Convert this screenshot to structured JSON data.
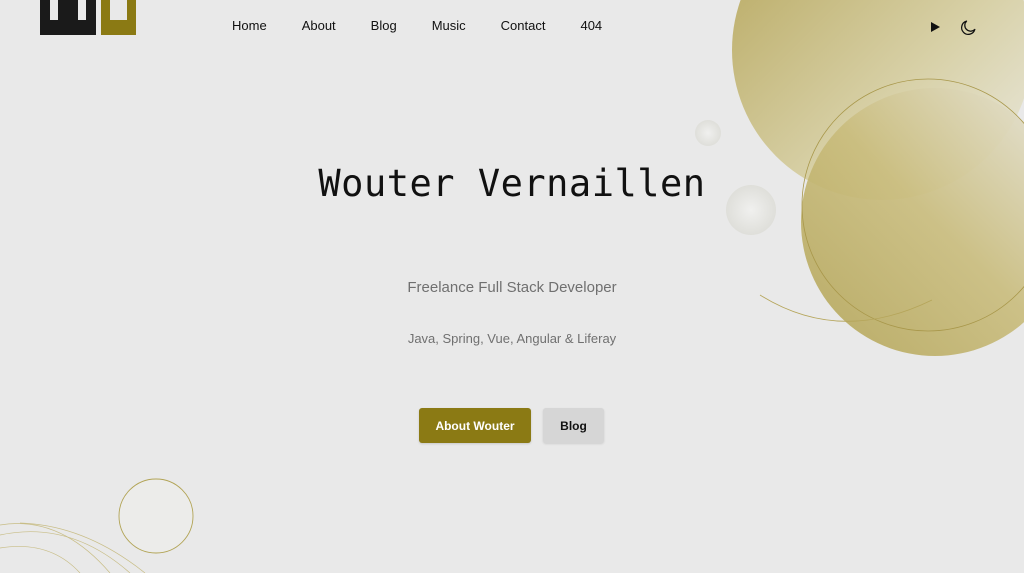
{
  "header": {
    "logo": "WV-logo",
    "nav": [
      {
        "label": "Home"
      },
      {
        "label": "About"
      },
      {
        "label": "Blog"
      },
      {
        "label": "Music"
      },
      {
        "label": "Contact"
      },
      {
        "label": "404"
      }
    ],
    "icons": [
      "play-icon",
      "moon-icon"
    ]
  },
  "hero": {
    "title": "Wouter Vernaillen",
    "subtitle": "Freelance Full Stack Developer",
    "tech": "Java, Spring, Vue, Angular & Liferay",
    "primary_button": "About Wouter",
    "secondary_button": "Blog"
  },
  "colors": {
    "background": "#e9e9e9",
    "accent": "#8b7a14",
    "secondary_button": "#d6d6d6",
    "text": "#111111",
    "muted_text": "#707070"
  }
}
